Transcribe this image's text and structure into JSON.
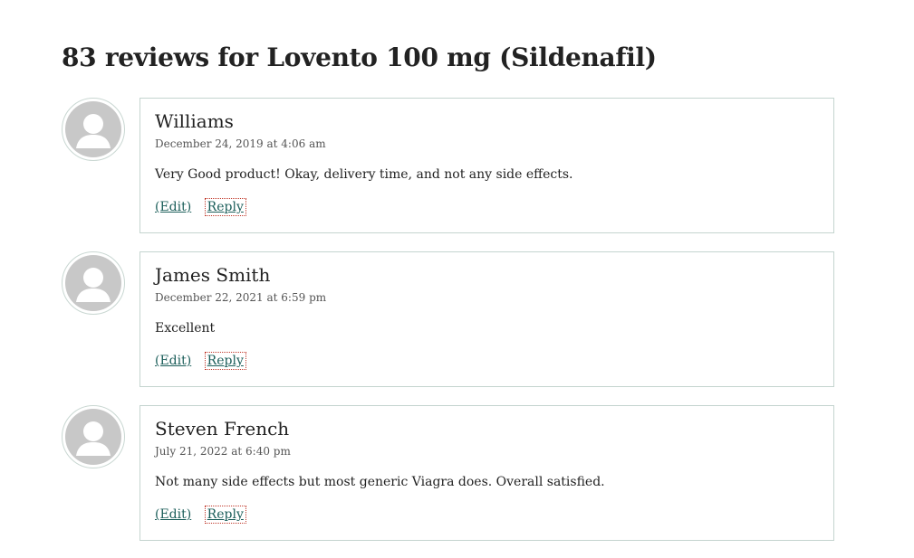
{
  "reviews_title": "83 reviews for Lovento 100 mg (Sildenafil)",
  "reviews": [
    {
      "author": "Williams",
      "date": "December 24, 2019 at 4:06 am",
      "text": "Very Good product! Okay, delivery time, and not any side effects.",
      "edit_label": "(Edit)",
      "reply_label": "Reply"
    },
    {
      "author": "James Smith",
      "date": "December 22, 2021 at 6:59 pm",
      "text": "Excellent",
      "edit_label": "(Edit)",
      "reply_label": "Reply"
    },
    {
      "author": "Steven French",
      "date": "July 21, 2022 at 6:40 pm",
      "text": "Not many side effects but most generic Viagra does. Overall satisfied.",
      "edit_label": "(Edit)",
      "reply_label": "Reply"
    }
  ],
  "icons": {
    "avatar": "default-user-avatar-icon"
  },
  "colors": {
    "link": "#1b5e5a",
    "box_border": "#c4d4cf",
    "avatar_fill": "#c8c8c8"
  }
}
